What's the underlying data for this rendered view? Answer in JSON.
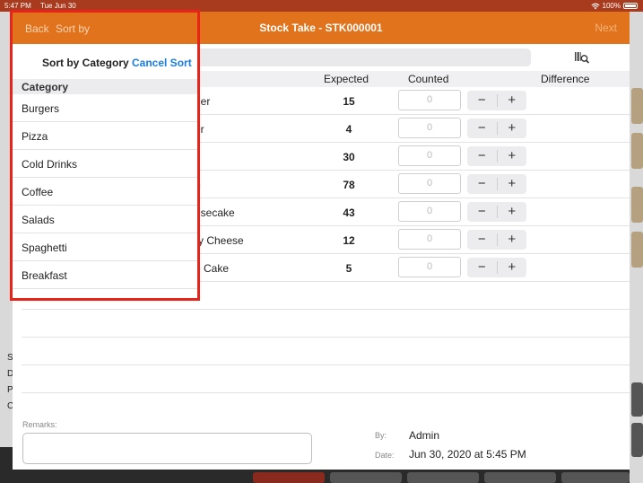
{
  "status_bar": {
    "time": "5:47 PM",
    "date": "Tue Jun 30",
    "battery": "100%"
  },
  "navbar": {
    "title": "Stock Take - STK000001",
    "next_label": "Next"
  },
  "table": {
    "headers": {
      "name": "e",
      "expected": "Expected",
      "counted": "Counted",
      "difference": "Difference"
    },
    "rows": [
      {
        "name": "ger",
        "expected": "15",
        "counted_placeholder": "0"
      },
      {
        "name": "er",
        "expected": "4",
        "counted_placeholder": "0"
      },
      {
        "name": "",
        "expected": "30",
        "counted_placeholder": "0"
      },
      {
        "name": "e",
        "expected": "78",
        "counted_placeholder": "0"
      },
      {
        "name": "esecake",
        "expected": "43",
        "counted_placeholder": "0"
      },
      {
        "name": "ry Cheese",
        "expected": "12",
        "counted_placeholder": "0"
      },
      {
        "name": "e Cake",
        "expected": "5",
        "counted_placeholder": "0"
      }
    ],
    "stepper": {
      "minus": "−",
      "plus": "+"
    }
  },
  "footer": {
    "remarks_label": "Remarks:",
    "by_label": "By:",
    "by_value": "Admin",
    "date_label": "Date:",
    "date_value": "Jun 30, 2020 at 5:45 PM"
  },
  "sort_popover": {
    "back_label": "Back",
    "sort_by_label": "Sort by",
    "title": "Sort by Category",
    "cancel_label": "Cancel Sort",
    "category_header": "Category",
    "categories": [
      "Burgers",
      "Pizza",
      "Cold Drinks",
      "Coffee",
      "Salads",
      "Spaghetti",
      "Breakfast"
    ]
  },
  "background_letters": [
    "S",
    "D",
    "P",
    "C"
  ],
  "colors": {
    "accent": "#e0731c",
    "highlight": "#e8231a",
    "link": "#1a7ee0"
  },
  "icons": {
    "scan": "barcode-scan-icon",
    "wifi": "wifi-icon",
    "battery": "battery-icon"
  }
}
